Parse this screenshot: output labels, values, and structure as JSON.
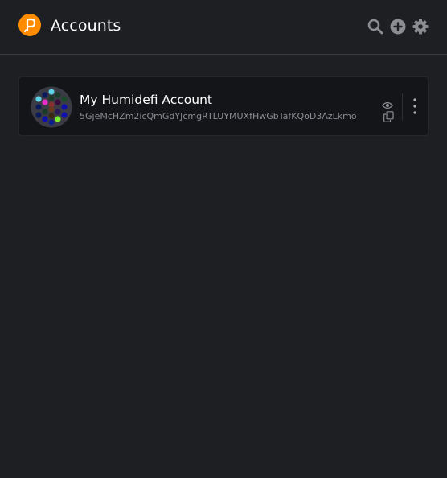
{
  "header": {
    "title": "Accounts",
    "logo_icon": "polkadot-logo",
    "actions": [
      {
        "name": "search",
        "icon": "search-icon"
      },
      {
        "name": "add-account",
        "icon": "plus-circle-icon"
      },
      {
        "name": "settings",
        "icon": "gear-icon"
      }
    ]
  },
  "accounts": [
    {
      "name": "My Humidefi Account",
      "address": "5GjeMcHZm2icQmGdYJcmgRTLUYMUXfHwGbTafKQoD3AzLkmo",
      "actions": [
        "eye-icon",
        "copy-icon",
        "more-vertical-icon"
      ]
    }
  ],
  "colors": {
    "background": "#1e1f23",
    "card": "#141518",
    "accent": "#ff8c00",
    "icon": "#8c8c93",
    "text": "#ffffff",
    "address": "#8c8c93"
  }
}
